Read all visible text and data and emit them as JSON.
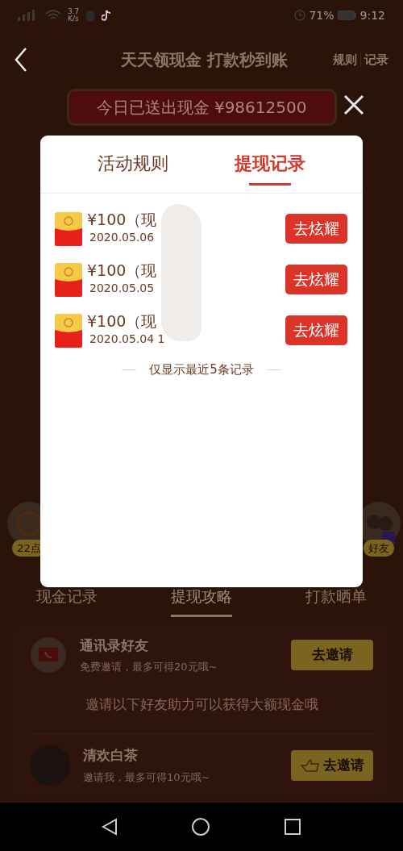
{
  "status_bar": {
    "speed_value": "3.7",
    "speed_unit": "K/s",
    "battery": "71%",
    "time": "9:12"
  },
  "header": {
    "title": "天天领现金 打款秒到账",
    "links": [
      "规则",
      "记录"
    ]
  },
  "banner": {
    "text": "今日已送出现金 ¥98612500"
  },
  "side_badges": [
    "22点",
    "好友"
  ],
  "page_tabs": [
    {
      "label": "现金记录",
      "selected": false
    },
    {
      "label": "提现攻略",
      "selected": true
    },
    {
      "label": "打款晒单",
      "selected": false
    }
  ],
  "invite_card": {
    "contact": {
      "title": "通讯录好友",
      "subtitle": "免费邀请，最多可得20元哦~",
      "button": "去邀请"
    },
    "hint": "邀请以下好友助力可以获得大额现金哦",
    "friends": [
      {
        "name": "清欢白茶",
        "subtitle": "邀请我，最多可得10元哦~",
        "button": "去邀请"
      }
    ]
  },
  "modal": {
    "tabs": [
      {
        "label": "活动规则",
        "selected": false
      },
      {
        "label": "提现记录",
        "selected": true
      }
    ],
    "records": [
      {
        "amount": "¥100（现",
        "date": "2020.05.06",
        "button": "去炫耀"
      },
      {
        "amount": "¥100（现",
        "date": "2020.05.05",
        "button": "去炫耀"
      },
      {
        "amount": "¥100（现",
        "date": "2020.05.04 1",
        "button": "去炫耀"
      }
    ],
    "footer_note": "仅显示最近5条记录"
  }
}
